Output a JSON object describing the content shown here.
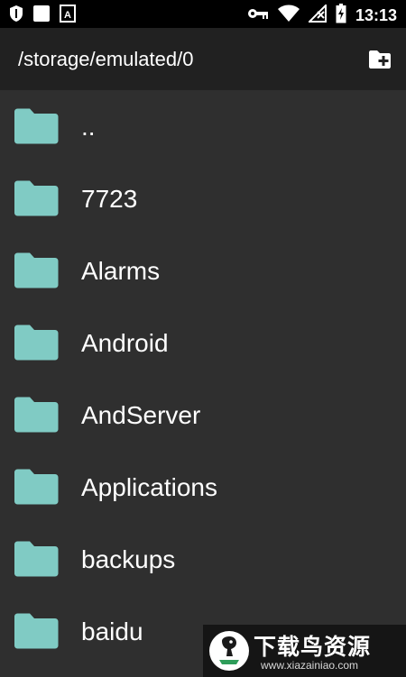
{
  "status_bar": {
    "time": "13:13",
    "icons": [
      "shield-icon",
      "square-icon",
      "a-box-icon",
      "key-icon",
      "wifi-icon",
      "no-signal-icon",
      "battery-charging-icon"
    ]
  },
  "app_bar": {
    "path": "/storage/emulated/0",
    "action_icon": "create-new-folder-icon"
  },
  "folders": [
    {
      "name": ".."
    },
    {
      "name": "7723"
    },
    {
      "name": "Alarms"
    },
    {
      "name": "Android"
    },
    {
      "name": "AndServer"
    },
    {
      "name": "Applications"
    },
    {
      "name": "backups"
    },
    {
      "name": "baidu"
    }
  ],
  "colors": {
    "folder": "#80cbc4",
    "background": "#2f2f2f",
    "app_bar": "#212121",
    "status_bar": "#000000"
  },
  "watermark": {
    "title": "下载鸟资源",
    "url": "www.xiazainiao.com"
  }
}
